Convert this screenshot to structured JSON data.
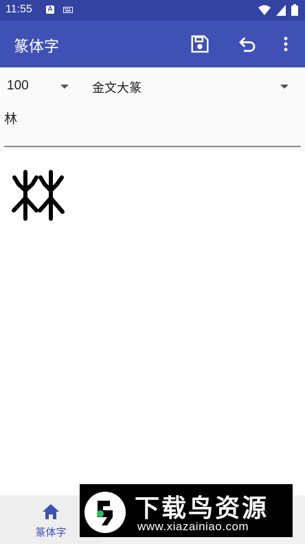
{
  "status_bar": {
    "time": "11:55",
    "notification_letter": "A"
  },
  "app_bar": {
    "title": "篆体字",
    "icons": [
      "save-icon",
      "undo-icon",
      "more-vert-icon"
    ]
  },
  "options": {
    "font_size": "100",
    "font_style": "金文大篆",
    "input_text": "林"
  },
  "preview": {
    "glyph": "林"
  },
  "bottom_nav": {
    "home_label": "篆体字"
  },
  "ad_banner": {
    "title": "下载鸟资源",
    "url": "www.xiazainiao.com"
  },
  "colors": {
    "primary": "#3f51b5",
    "status_bar": "#3243a2"
  }
}
